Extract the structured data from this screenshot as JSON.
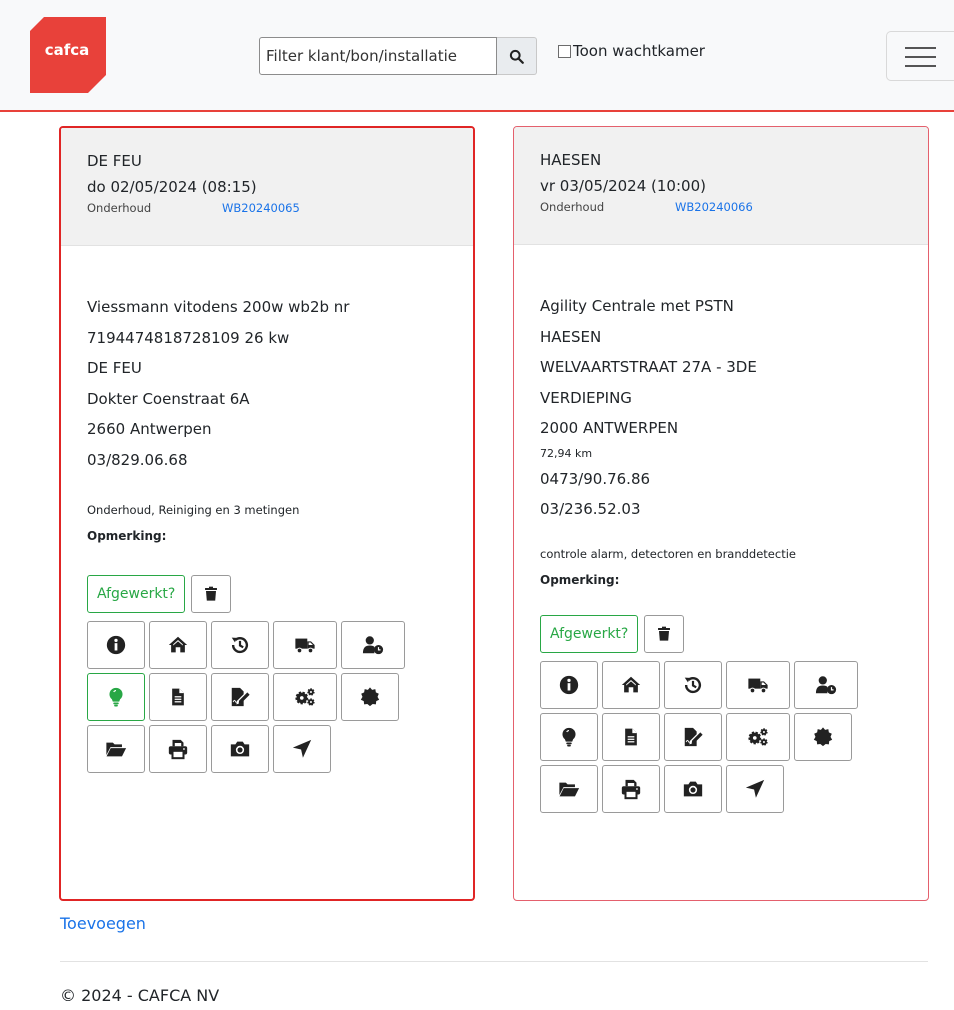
{
  "header": {
    "logo_text": "cafca",
    "search_placeholder": "Filter klant/bon/installatie",
    "waiting_room_label": "Toon wachtkamer"
  },
  "cards": [
    {
      "customer": "DE FEU",
      "datetime": "do 02/05/2024 (08:15)",
      "type": "Onderhoud",
      "bon": "WB20240065",
      "lines": [
        "Viessmann vitodens 200w wb2b nr",
        "7194474818728109 26 kw",
        "DE FEU",
        "Dokter Coenstraat 6A",
        "2660 Antwerpen",
        "03/829.06.68"
      ],
      "description": "Onderhoud, Reiniging en 3 metingen",
      "remark_label": "Opmerking:",
      "done_label": "Afgewerkt?"
    },
    {
      "customer": "HAESEN",
      "datetime": "vr 03/05/2024 (10:00)",
      "type": "Onderhoud",
      "bon": "WB20240066",
      "lines": [
        "Agility Centrale met PSTN",
        "HAESEN",
        "WELVAARTSTRAAT 27A - 3DE",
        "VERDIEPING",
        "2000 ANTWERPEN"
      ],
      "distance": "72,94 km",
      "phones": [
        "0473/90.76.86",
        "03/236.52.03"
      ],
      "description": "controle alarm, detectoren en branddetectie",
      "remark_label": "Opmerking:",
      "done_label": "Afgewerkt?"
    }
  ],
  "add_label": "Toevoegen",
  "footer": "© 2024 - CAFCA NV",
  "icons": [
    "info-icon",
    "home-icon",
    "history-icon",
    "truck-icon",
    "user-clock-icon",
    "lightbulb-icon",
    "document-icon",
    "signature-icon",
    "cogs-icon",
    "certificate-icon",
    "folder-open-icon",
    "print-icon",
    "camera-icon",
    "location-arrow-icon"
  ],
  "colors": {
    "brand_red": "#e8413a",
    "link_blue": "#1a73e8",
    "success_green": "#28a745"
  }
}
